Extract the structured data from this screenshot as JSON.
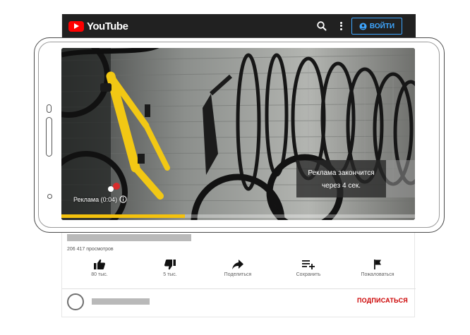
{
  "header": {
    "logo_text": "YouTube",
    "signin_label": "ВОЙТИ"
  },
  "player": {
    "ad_label": "Реклама (0:04)",
    "ad_countdown_line1": "Реклама закончится",
    "ad_countdown_line2": "через 4 сек.",
    "ad_progress": 0.35,
    "progress_color": "#f4c20d"
  },
  "video": {
    "views": "206 417 просмотров"
  },
  "actions": [
    {
      "id": "like",
      "label": "80 тыс.",
      "icon": "thumbs-up-icon"
    },
    {
      "id": "dislike",
      "label": "5 тыс.",
      "icon": "thumbs-down-icon"
    },
    {
      "id": "share",
      "label": "Поделиться",
      "icon": "share-icon"
    },
    {
      "id": "save",
      "label": "Сохранить",
      "icon": "playlist-add-icon"
    },
    {
      "id": "report",
      "label": "Пожаловаться",
      "icon": "flag-icon"
    }
  ],
  "channel": {
    "subscribe_label": "ПОДПИСАТЬСЯ"
  },
  "colors": {
    "header_bg": "#212121",
    "brand_red": "#ff0000",
    "signin_blue": "#3ea6ff",
    "subscribe_red": "#cc0000"
  }
}
